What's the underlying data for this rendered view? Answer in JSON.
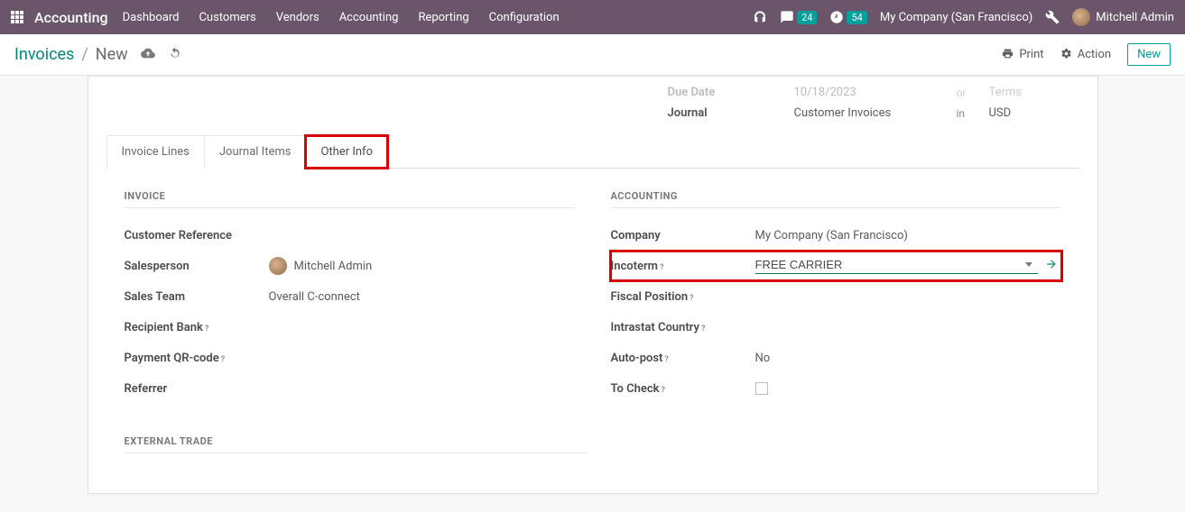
{
  "navbar": {
    "brand": "Accounting",
    "menu": [
      "Dashboard",
      "Customers",
      "Vendors",
      "Accounting",
      "Reporting",
      "Configuration"
    ],
    "messages_count": "24",
    "activities_count": "54",
    "company": "My Company (San Francisco)",
    "user": "Mitchell Admin"
  },
  "control": {
    "breadcrumb_root": "Invoices",
    "breadcrumb_current": "New",
    "print": "Print",
    "action": "Action",
    "new": "New"
  },
  "header_fields": {
    "due_date_label": "Due Date",
    "due_date_value": "10/18/2023",
    "due_or": "or",
    "due_terms": "Terms",
    "journal_label": "Journal",
    "journal_value": "Customer Invoices",
    "journal_in": "in",
    "journal_currency": "USD"
  },
  "tabs": {
    "invoice_lines": "Invoice Lines",
    "journal_items": "Journal Items",
    "other_info": "Other Info"
  },
  "invoice_section": {
    "title": "INVOICE",
    "customer_ref_label": "Customer Reference",
    "salesperson_label": "Salesperson",
    "salesperson_value": "Mitchell Admin",
    "sales_team_label": "Sales Team",
    "sales_team_value": "Overall C-connect",
    "recipient_bank_label": "Recipient Bank",
    "payment_qr_label": "Payment QR-code",
    "referrer_label": "Referrer"
  },
  "accounting_section": {
    "title": "ACCOUNTING",
    "company_label": "Company",
    "company_value": "My Company (San Francisco)",
    "incoterm_label": "Incoterm",
    "incoterm_value": "FREE CARRIER",
    "fiscal_label": "Fiscal Position",
    "intrastat_label": "Intrastat Country",
    "autopost_label": "Auto-post",
    "autopost_value": "No",
    "tocheck_label": "To Check"
  },
  "external_trade": {
    "title": "EXTERNAL TRADE"
  }
}
